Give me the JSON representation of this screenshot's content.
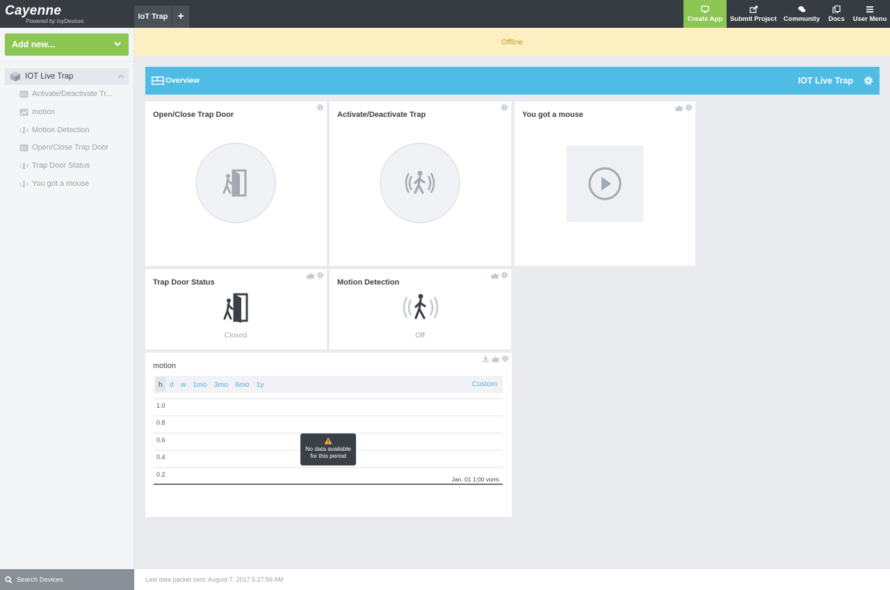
{
  "app": {
    "brand": "Cayenne",
    "brand_sub": "Powered by myDevices"
  },
  "tabs": [
    {
      "label": "IoT Trap"
    }
  ],
  "topnav": {
    "create_app": "Create App",
    "submit_project": "Submit Project",
    "community": "Community",
    "docs": "Docs",
    "user_menu": "User Menu"
  },
  "colors": {
    "accent_green": "#8cc653",
    "overview_blue": "#4fbce6",
    "offline_bg": "#fcf0c3",
    "offline_text": "#c29a2f"
  },
  "sidebar": {
    "add_new": "Add new...",
    "device": {
      "name": "IOT Live Trap",
      "icon": "cube-icon"
    },
    "items": [
      {
        "label": "Activate/Deactivate Tr...",
        "icon": "toggle-icon"
      },
      {
        "label": "motion",
        "icon": "chart-icon"
      },
      {
        "label": "Motion Detection",
        "icon": "motion-icon"
      },
      {
        "label": "Open/Close Trap Door",
        "icon": "toggle-icon"
      },
      {
        "label": "Trap Door Status",
        "icon": "motion-icon"
      },
      {
        "label": "You got a mouse",
        "icon": "motion-icon"
      }
    ],
    "search_label": "Search Devices"
  },
  "status_bar": {
    "text": "Offline"
  },
  "overview": {
    "label": "Overview",
    "device_name": "IOT Live Trap"
  },
  "widgets": {
    "open_close": {
      "title": "Open/Close Trap Door",
      "icon": "door-icon"
    },
    "activate": {
      "title": "Activate/Deactivate Trap",
      "icon": "motion-icon"
    },
    "mouse": {
      "title": "You got a mouse",
      "icon": "play-icon"
    },
    "door_status": {
      "title": "Trap Door Status",
      "value": "Closed",
      "icon": "door-icon"
    },
    "motion_detect": {
      "title": "Motion Detection",
      "value": "Off",
      "icon": "motion-icon"
    },
    "motion_chart": {
      "title": "motion",
      "ranges": [
        "h",
        "d",
        "w",
        "1mo",
        "3mo",
        "6mo",
        "1y"
      ],
      "active_range": "h",
      "custom_label": "Custom",
      "y_ticks": [
        "1.0",
        "0.8",
        "0.6",
        "0.4",
        "0.2"
      ],
      "x_label": "Jan. 01 1:00 vorm.",
      "tooltip_line1": "No data available",
      "tooltip_line2": "for this period"
    }
  },
  "chart_data": {
    "type": "line",
    "title": "motion",
    "series": [],
    "y_ticks": [
      1.0,
      0.8,
      0.6,
      0.4,
      0.2
    ],
    "x_ticks": [
      "Jan. 01 1:00 vorm."
    ],
    "grid": true,
    "annotations": [
      "No data available for this period"
    ]
  },
  "footer": {
    "text": "Last data packet sent: August 7, 2017 5:27:56 AM"
  }
}
